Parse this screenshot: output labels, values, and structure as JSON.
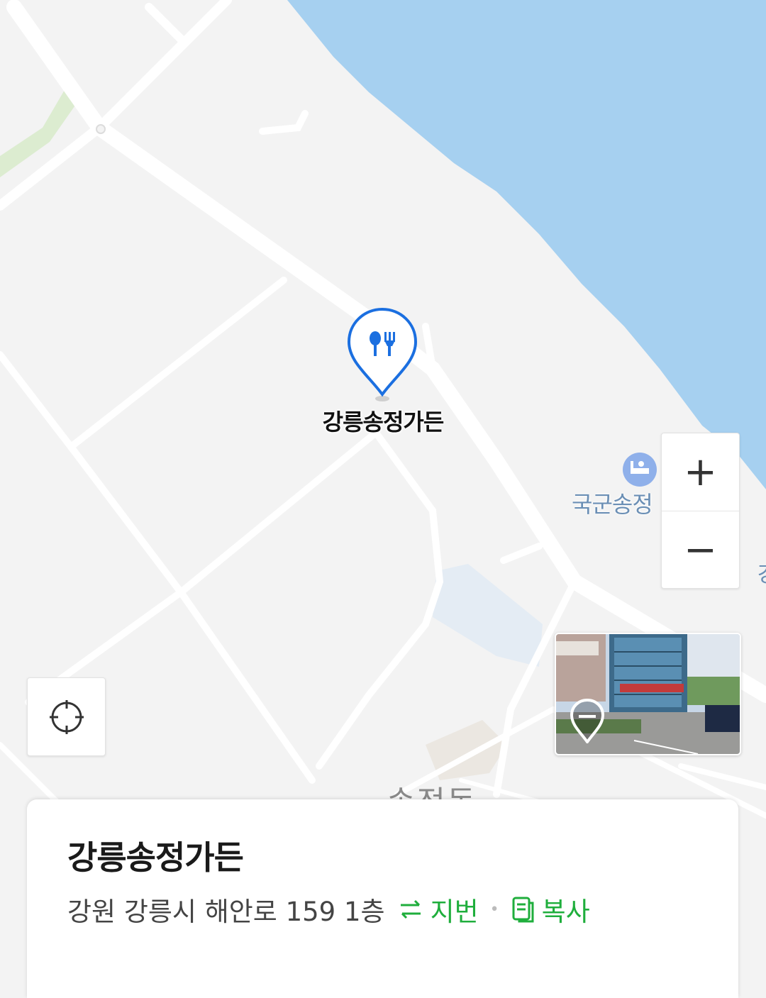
{
  "map": {
    "place_marker": {
      "label": "강릉송정가든",
      "icon": "restaurant-icon"
    },
    "poi": {
      "label": "국군송정",
      "icon": "lodging-icon"
    },
    "area_label": "송정동",
    "colors": {
      "water": "#a6d0f0",
      "land": "#f3f3f3",
      "road": "#ffffff",
      "marker": "#1b6fe0",
      "green": "#dcecd0"
    }
  },
  "controls": {
    "zoom_in": "+",
    "zoom_out": "−",
    "locate_icon": "crosshair-icon",
    "street_view_icon": "street-view-pin-icon"
  },
  "place_card": {
    "title": "강릉송정가든",
    "address": "강원 강릉시 해안로 159 1층",
    "lot_number_label": "지번",
    "lot_number_icon": "swap-icon",
    "copy_label": "복사",
    "copy_icon": "copy-icon",
    "accent_color": "#1fae3c"
  }
}
